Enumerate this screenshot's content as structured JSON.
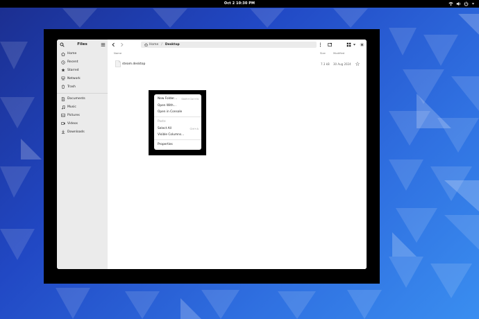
{
  "topbar": {
    "clock": "Oct 2  10:30 PM",
    "tray_icons": [
      "network-wired-icon",
      "volume-icon",
      "power-icon",
      "menu-arrow-icon"
    ]
  },
  "colors": {
    "wallpaper_dark": "#1b2e8f",
    "wallpaper_light": "#3a8ef0",
    "sidebar_bg": "#ebebeb",
    "window_bg": "#ffffff",
    "frame_bg": "#000000"
  },
  "sidebar": {
    "title": "Files",
    "places": [
      {
        "label": "Home",
        "icon": "home-icon"
      },
      {
        "label": "Recent",
        "icon": "clock-icon"
      },
      {
        "label": "Starred",
        "icon": "star-icon"
      },
      {
        "label": "Network",
        "icon": "network-icon"
      },
      {
        "label": "Trash",
        "icon": "trash-icon"
      }
    ],
    "bookmarks": [
      {
        "label": "Documents",
        "icon": "documents-icon"
      },
      {
        "label": "Music",
        "icon": "music-icon"
      },
      {
        "label": "Pictures",
        "icon": "pictures-icon"
      },
      {
        "label": "Videos",
        "icon": "videos-icon"
      },
      {
        "label": "Downloads",
        "icon": "downloads-icon"
      }
    ]
  },
  "pathbar": {
    "home_label": "Home",
    "current_label": "Desktop"
  },
  "columns": {
    "name": "Name",
    "size": "Size",
    "modified": "Modified"
  },
  "files": [
    {
      "name": "steam.desktop",
      "size": "7.3 kB",
      "modified": "30 Aug 2024"
    }
  ],
  "context_menu": {
    "items": [
      {
        "label": "New Folder…",
        "accel": "Shift+Ctrl+N",
        "enabled": true
      },
      {
        "label": "Open With…",
        "accel": "",
        "enabled": true
      },
      {
        "label": "Open in Console",
        "accel": "",
        "enabled": true
      },
      {
        "label": "Paste",
        "accel": "",
        "enabled": false
      },
      {
        "label": "Select All",
        "accel": "Ctrl+A",
        "enabled": true
      },
      {
        "label": "Visible Columns…",
        "accel": "",
        "enabled": true
      },
      {
        "label": "Properties",
        "accel": "",
        "enabled": true
      }
    ]
  }
}
